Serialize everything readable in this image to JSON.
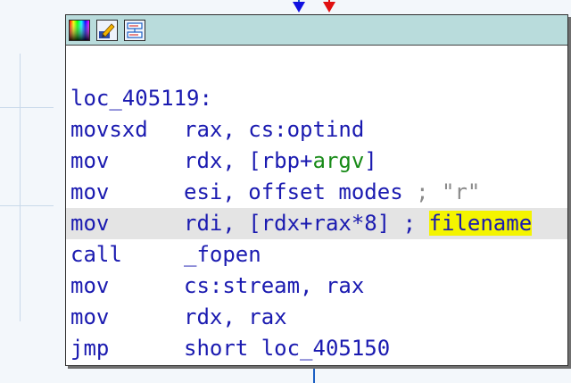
{
  "window": {
    "background": "#f3f7fb",
    "node_header_color": "#b9dcdc",
    "edge_arrows": [
      {
        "color": "#1010e0",
        "meaning": "taken"
      },
      {
        "color": "#e01010",
        "meaning": "not-taken"
      }
    ]
  },
  "header_icons": [
    "color-palette-icon",
    "edit-pencil-icon",
    "graph-node-icon"
  ],
  "code": {
    "label": "loc_405119:",
    "lines": [
      {
        "mnemonic": "movsxd",
        "operands": "rax, cs:optind"
      },
      {
        "mnemonic": "mov",
        "pre": "rdx, [rbp+",
        "var": "argv",
        "post": "]"
      },
      {
        "mnemonic": "mov",
        "operands": "esi, offset modes",
        "comment_sep": " ; ",
        "comment": "\"r\""
      },
      {
        "mnemonic": "mov",
        "operands": "rdi, [rdx+rax*8]",
        "comment_sep": " ; ",
        "highlight_word": "filename",
        "highlighted": true
      },
      {
        "mnemonic": "call",
        "operands": "_fopen"
      },
      {
        "mnemonic": "mov",
        "operands": "cs:stream, rax"
      },
      {
        "mnemonic": "mov",
        "operands": "rdx, rax"
      },
      {
        "mnemonic": "jmp",
        "operands": "short loc_405150"
      }
    ]
  }
}
